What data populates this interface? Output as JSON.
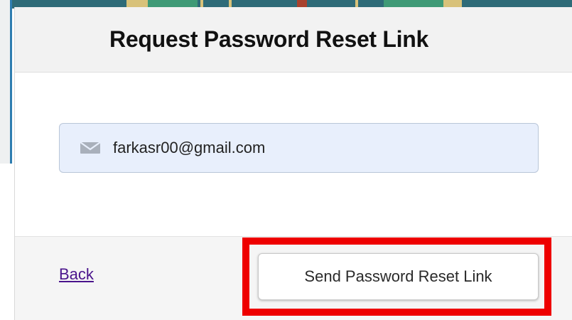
{
  "dialog": {
    "title": "Request Password Reset Link"
  },
  "email_field": {
    "value": "farkasr00@gmail.com",
    "icon": "envelope-icon"
  },
  "footer": {
    "back_label": "Back",
    "send_label": "Send Password Reset Link"
  },
  "annotation": {
    "highlight_color": "#ee0000",
    "target": "send-password-reset-button"
  },
  "colors": {
    "header_bg": "#f2f2f2",
    "field_bg": "#e8effc",
    "footer_bg": "#f5f5f5",
    "link": "#4a148c",
    "backdrop": "#2e6b78"
  }
}
